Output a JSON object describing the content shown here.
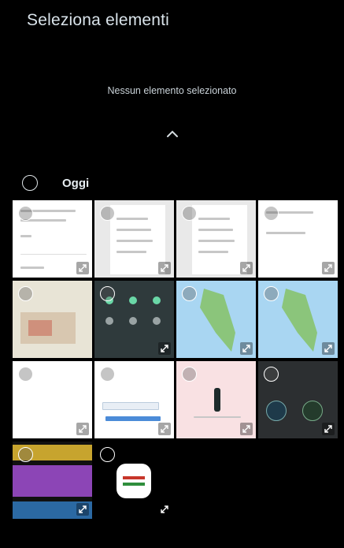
{
  "header": {
    "title": "Seleziona elementi"
  },
  "selection": {
    "status_text": "Nessun elemento selezionato"
  },
  "group": {
    "date_label": "Oggi"
  },
  "thumbnails": [
    {
      "type": "document-screenshot"
    },
    {
      "type": "menu-screenshot"
    },
    {
      "type": "menu-screenshot"
    },
    {
      "type": "document-screenshot"
    },
    {
      "type": "map"
    },
    {
      "type": "quick-settings-screenshot"
    },
    {
      "type": "map-italy"
    },
    {
      "type": "map-italy"
    },
    {
      "type": "blank-document"
    },
    {
      "type": "form-screenshot"
    },
    {
      "type": "illustration"
    },
    {
      "type": "dark-screenshot"
    },
    {
      "type": "colored-cards"
    },
    {
      "type": "app-logo"
    }
  ],
  "icons": {
    "collapse": "chevron-up-icon",
    "select": "radio-circle-icon",
    "expand": "expand-icon"
  },
  "colors": {
    "background": "#000000",
    "title": "#d9e3ea",
    "text": "#c9d2d8"
  }
}
